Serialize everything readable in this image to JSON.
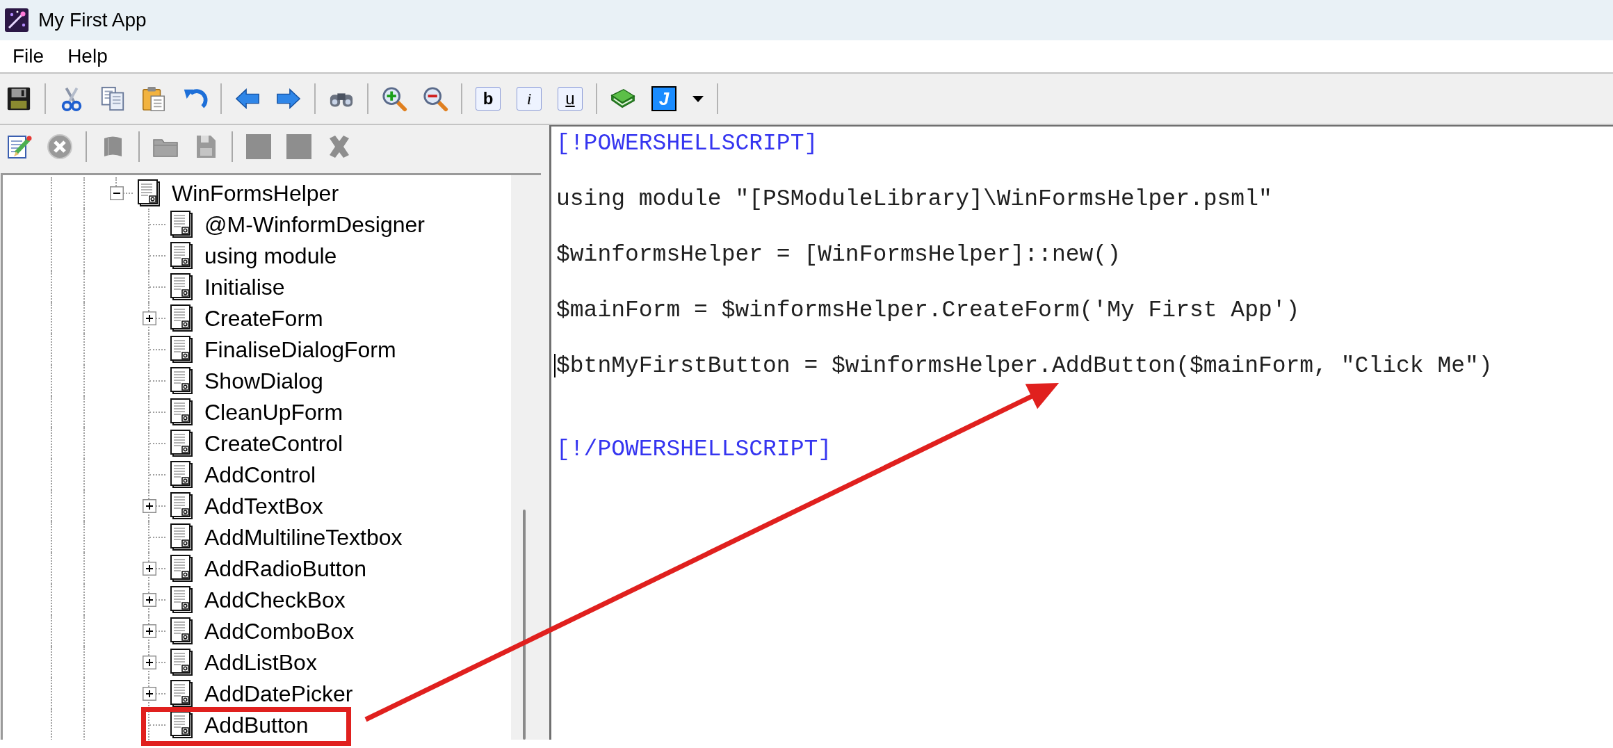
{
  "window": {
    "title": "My First App"
  },
  "menu_bar": [
    {
      "label": "File"
    },
    {
      "label": "Help"
    }
  ],
  "toolbar": {
    "format_buttons": [
      {
        "label": "b"
      },
      {
        "label": "i"
      },
      {
        "label": "u"
      }
    ],
    "script_button": {
      "label": "J"
    }
  },
  "panel_toolbar": {
    "groups": [
      [
        {
          "disabled": false
        },
        {
          "disabled": true
        }
      ],
      [
        {
          "disabled": true
        }
      ],
      [
        {
          "disabled": true
        },
        {
          "disabled": true
        }
      ],
      [
        {
          "disabled": true
        },
        {
          "disabled": true
        },
        {
          "disabled": true
        }
      ]
    ]
  },
  "tree": {
    "items": [
      {
        "label": "WinFormsHelper",
        "has_children": true,
        "expanded": true,
        "highlighted": false,
        "children": [
          {
            "label": "@M-WinformDesigner",
            "has_children": false,
            "expanded": false,
            "highlighted": false
          },
          {
            "label": "using module",
            "has_children": false,
            "expanded": false,
            "highlighted": false
          },
          {
            "label": "Initialise",
            "has_children": false,
            "expanded": false,
            "highlighted": false
          },
          {
            "label": "CreateForm",
            "has_children": true,
            "expanded": false,
            "highlighted": false
          },
          {
            "label": "FinaliseDialogForm",
            "has_children": false,
            "expanded": false,
            "highlighted": false
          },
          {
            "label": "ShowDialog",
            "has_children": false,
            "expanded": false,
            "highlighted": false
          },
          {
            "label": "CleanUpForm",
            "has_children": false,
            "expanded": false,
            "highlighted": false
          },
          {
            "label": "CreateControl",
            "has_children": false,
            "expanded": false,
            "highlighted": false
          },
          {
            "label": "AddControl",
            "has_children": false,
            "expanded": false,
            "highlighted": false
          },
          {
            "label": "AddTextBox",
            "has_children": true,
            "expanded": false,
            "highlighted": false
          },
          {
            "label": "AddMultilineTextbox",
            "has_children": false,
            "expanded": false,
            "highlighted": false
          },
          {
            "label": "AddRadioButton",
            "has_children": true,
            "expanded": false,
            "highlighted": false
          },
          {
            "label": "AddCheckBox",
            "has_children": true,
            "expanded": false,
            "highlighted": false
          },
          {
            "label": "AddComboBox",
            "has_children": true,
            "expanded": false,
            "highlighted": false
          },
          {
            "label": "AddListBox",
            "has_children": true,
            "expanded": false,
            "highlighted": false
          },
          {
            "label": "AddDatePicker",
            "has_children": true,
            "expanded": false,
            "highlighted": false
          },
          {
            "label": "AddButton",
            "has_children": false,
            "expanded": false,
            "highlighted": true
          }
        ]
      }
    ]
  },
  "editor": {
    "lines": [
      {
        "kind": "tag",
        "text": "[!POWERSHELLSCRIPT]",
        "caret": false
      },
      {
        "kind": "blank",
        "caret": false
      },
      {
        "kind": "code",
        "text": "using module \"[PSModuleLibrary]\\WinFormsHelper.psml\"",
        "caret": false
      },
      {
        "kind": "blank",
        "caret": false
      },
      {
        "kind": "code",
        "text": "$winformsHelper = [WinFormsHelper]::new()",
        "caret": false
      },
      {
        "kind": "blank",
        "caret": false
      },
      {
        "kind": "code",
        "text": "$mainForm = $winformsHelper.CreateForm('My First App')",
        "caret": false
      },
      {
        "kind": "blank",
        "caret": false
      },
      {
        "kind": "code",
        "text": "$btnMyFirstButton = $winformsHelper.AddButton($mainForm, \"Click Me\")",
        "caret": true
      },
      {
        "kind": "blank",
        "caret": false
      },
      {
        "kind": "blank",
        "caret": false
      },
      {
        "kind": "tag",
        "text": "[!/POWERSHELLSCRIPT]",
        "caret": false
      }
    ]
  }
}
